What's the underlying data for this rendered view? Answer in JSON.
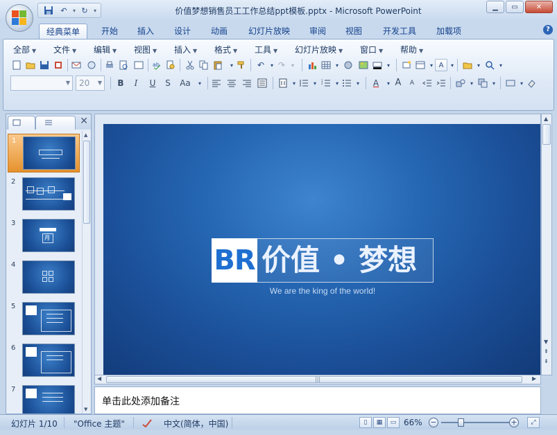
{
  "window": {
    "title": "价值梦想销售员工工作总结ppt模板.pptx - Microsoft PowerPoint",
    "min_glyph": "▁",
    "max_glyph": "▭",
    "close_glyph": "✕"
  },
  "qat": {
    "save_glyph": "💾",
    "undo_glyph": "↶",
    "redo_glyph": "↻",
    "more_glyph": "▾"
  },
  "tabs": [
    "经典菜单",
    "开始",
    "插入",
    "设计",
    "动画",
    "幻灯片放映",
    "审阅",
    "视图",
    "开发工具",
    "加载项"
  ],
  "help_glyph": "?",
  "menus": [
    "全部",
    "文件",
    "编辑",
    "视图",
    "插入",
    "格式",
    "工具",
    "幻灯片放映",
    "窗口",
    "帮助"
  ],
  "toolbar": {
    "font_name": "",
    "font_size": "20",
    "bold": "B",
    "italic": "I",
    "underline": "U",
    "shadow": "S",
    "case": "Aa",
    "font_color": "A",
    "grow": "A",
    "shrink": "A",
    "text_box": "A"
  },
  "outline_pane": {
    "slides": [
      {
        "number": "1",
        "selected": true,
        "layout": "title"
      },
      {
        "number": "2",
        "selected": false,
        "layout": "timeline"
      },
      {
        "number": "3",
        "selected": false,
        "layout": "calendar"
      },
      {
        "number": "4",
        "selected": false,
        "layout": "grid"
      },
      {
        "number": "5",
        "selected": false,
        "layout": "list"
      },
      {
        "number": "6",
        "selected": false,
        "layout": "list"
      },
      {
        "number": "7",
        "selected": false,
        "layout": "list"
      }
    ],
    "thumb_month_label": "月"
  },
  "slide": {
    "logo": "BR",
    "title": "价值 • 梦想",
    "subtitle": "We are the king of the world!"
  },
  "notes": {
    "placeholder": "单击此处添加备注"
  },
  "status": {
    "slide_info": "幻灯片 1/10",
    "theme": "\"Office 主题\"",
    "language": "中文(简体，中国)",
    "zoom": "66%"
  }
}
